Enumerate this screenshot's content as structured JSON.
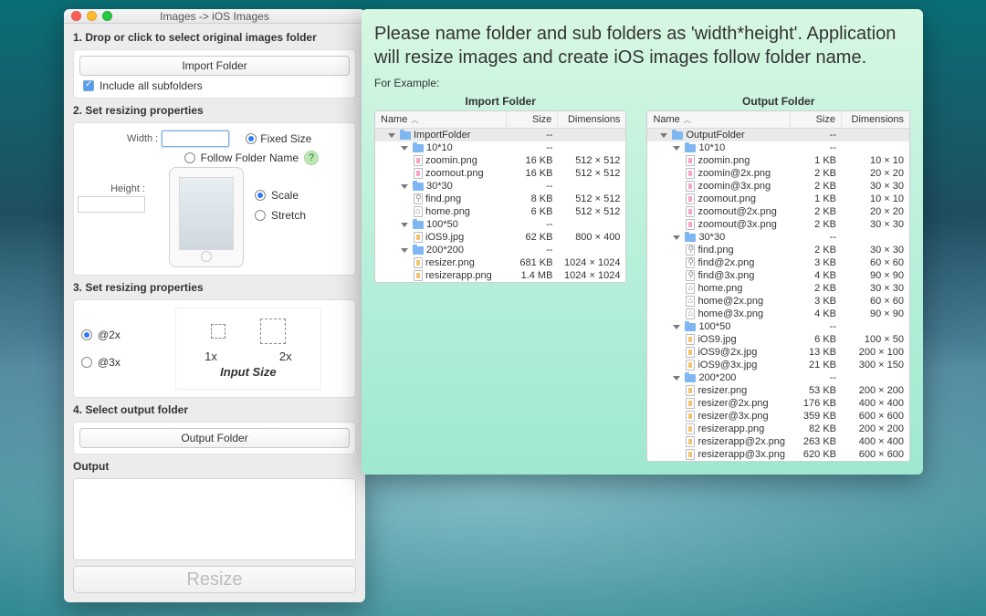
{
  "window": {
    "title": "Images -> iOS Images",
    "step1": "1. Drop or click to select original images folder",
    "import_btn": "Import Folder",
    "include_sub": "Include all subfolders",
    "step2": "2. Set resizing properties",
    "width_lbl": "Width :",
    "height_lbl": "Height :",
    "fixed": "Fixed Size",
    "follow": "Follow Folder Name",
    "scale": "Scale",
    "stretch": "Stretch",
    "step3": "3. Set resizing properties",
    "at2x": "@2x",
    "at3x": "@3x",
    "onex": "1x",
    "twox": "2x",
    "input_size": "Input Size",
    "step4": "4. Select output folder",
    "output_btn": "Output Folder",
    "output_lbl": "Output",
    "resize_btn": "Resize"
  },
  "info": {
    "headline": "Please name folder and sub folders as 'width*height'. Application will resize images and create iOS images follow folder name.",
    "forex": "For Example:",
    "import_title": "Import Folder",
    "output_title": "Output Folder",
    "cols": {
      "name": "Name",
      "size": "Size",
      "dim": "Dimensions"
    }
  },
  "import_tree": [
    {
      "d": 1,
      "t": "folder",
      "n": "ImportFolder",
      "s": "--",
      "dm": "",
      "sel": true
    },
    {
      "d": 2,
      "t": "folder",
      "n": "10*10",
      "s": "--",
      "dm": ""
    },
    {
      "d": 3,
      "t": "pink",
      "n": "zoomin.png",
      "s": "16 KB",
      "dm": "512 × 512"
    },
    {
      "d": 3,
      "t": "pink",
      "n": "zoomout.png",
      "s": "16 KB",
      "dm": "512 × 512"
    },
    {
      "d": 2,
      "t": "folder",
      "n": "30*30",
      "s": "--",
      "dm": ""
    },
    {
      "d": 3,
      "t": "mag",
      "n": "find.png",
      "s": "8 KB",
      "dm": "512 × 512"
    },
    {
      "d": 3,
      "t": "house",
      "n": "home.png",
      "s": "6 KB",
      "dm": "512 × 512"
    },
    {
      "d": 2,
      "t": "folder",
      "n": "100*50",
      "s": "--",
      "dm": ""
    },
    {
      "d": 3,
      "t": "img",
      "n": "iOS9.jpg",
      "s": "62 KB",
      "dm": "800 × 400"
    },
    {
      "d": 2,
      "t": "folder",
      "n": "200*200",
      "s": "--",
      "dm": ""
    },
    {
      "d": 3,
      "t": "img",
      "n": "resizer.png",
      "s": "681 KB",
      "dm": "1024 × 1024"
    },
    {
      "d": 3,
      "t": "img",
      "n": "resizerapp.png",
      "s": "1.4 MB",
      "dm": "1024 × 1024"
    }
  ],
  "output_tree": [
    {
      "d": 1,
      "t": "folder",
      "n": "OutputFolder",
      "s": "--",
      "dm": "",
      "sel": true
    },
    {
      "d": 2,
      "t": "folder",
      "n": "10*10",
      "s": "--",
      "dm": ""
    },
    {
      "d": 3,
      "t": "pink",
      "n": "zoomin.png",
      "s": "1 KB",
      "dm": "10 × 10"
    },
    {
      "d": 3,
      "t": "pink",
      "n": "zoomin@2x.png",
      "s": "2 KB",
      "dm": "20 × 20"
    },
    {
      "d": 3,
      "t": "pink",
      "n": "zoomin@3x.png",
      "s": "2 KB",
      "dm": "30 × 30"
    },
    {
      "d": 3,
      "t": "pink",
      "n": "zoomout.png",
      "s": "1 KB",
      "dm": "10 × 10"
    },
    {
      "d": 3,
      "t": "pink",
      "n": "zoomout@2x.png",
      "s": "2 KB",
      "dm": "20 × 20"
    },
    {
      "d": 3,
      "t": "pink",
      "n": "zoomout@3x.png",
      "s": "2 KB",
      "dm": "30 × 30"
    },
    {
      "d": 2,
      "t": "folder",
      "n": "30*30",
      "s": "--",
      "dm": ""
    },
    {
      "d": 3,
      "t": "mag",
      "n": "find.png",
      "s": "2 KB",
      "dm": "30 × 30"
    },
    {
      "d": 3,
      "t": "mag",
      "n": "find@2x.png",
      "s": "3 KB",
      "dm": "60 × 60"
    },
    {
      "d": 3,
      "t": "mag",
      "n": "find@3x.png",
      "s": "4 KB",
      "dm": "90 × 90"
    },
    {
      "d": 3,
      "t": "house",
      "n": "home.png",
      "s": "2 KB",
      "dm": "30 × 30"
    },
    {
      "d": 3,
      "t": "house",
      "n": "home@2x.png",
      "s": "3 KB",
      "dm": "60 × 60"
    },
    {
      "d": 3,
      "t": "house",
      "n": "home@3x.png",
      "s": "4 KB",
      "dm": "90 × 90"
    },
    {
      "d": 2,
      "t": "folder",
      "n": "100*50",
      "s": "--",
      "dm": ""
    },
    {
      "d": 3,
      "t": "img",
      "n": "iOS9.jpg",
      "s": "6 KB",
      "dm": "100 × 50"
    },
    {
      "d": 3,
      "t": "img",
      "n": "iOS9@2x.jpg",
      "s": "13 KB",
      "dm": "200 × 100"
    },
    {
      "d": 3,
      "t": "img",
      "n": "iOS9@3x.jpg",
      "s": "21 KB",
      "dm": "300 × 150"
    },
    {
      "d": 2,
      "t": "folder",
      "n": "200*200",
      "s": "--",
      "dm": ""
    },
    {
      "d": 3,
      "t": "img",
      "n": "resizer.png",
      "s": "53 KB",
      "dm": "200 × 200"
    },
    {
      "d": 3,
      "t": "img",
      "n": "resizer@2x.png",
      "s": "176 KB",
      "dm": "400 × 400"
    },
    {
      "d": 3,
      "t": "img",
      "n": "resizer@3x.png",
      "s": "359 KB",
      "dm": "600 × 600"
    },
    {
      "d": 3,
      "t": "img",
      "n": "resizerapp.png",
      "s": "82 KB",
      "dm": "200 × 200"
    },
    {
      "d": 3,
      "t": "img",
      "n": "resizerapp@2x.png",
      "s": "263 KB",
      "dm": "400 × 400"
    },
    {
      "d": 3,
      "t": "img",
      "n": "resizerapp@3x.png",
      "s": "620 KB",
      "dm": "600 × 600"
    }
  ]
}
